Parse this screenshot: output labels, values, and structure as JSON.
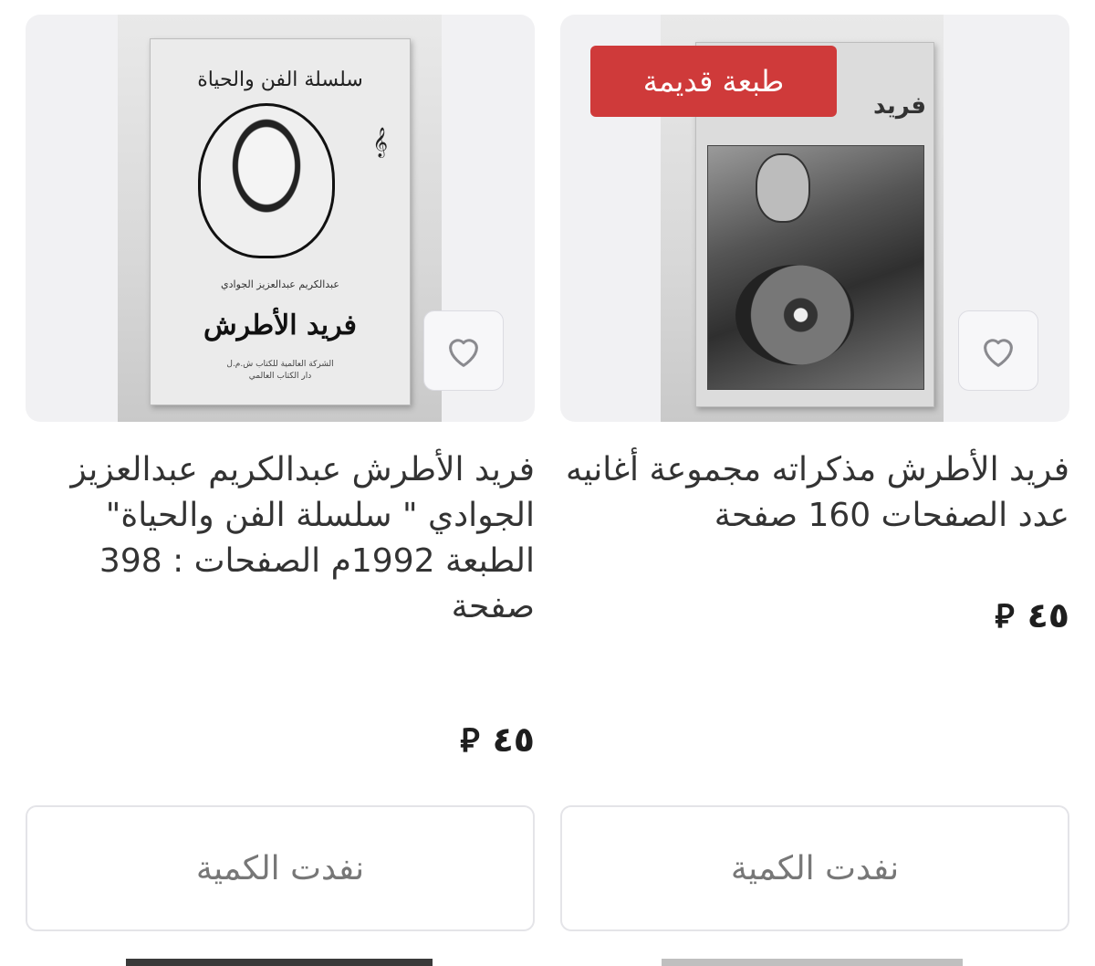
{
  "products": [
    {
      "badge": "طبعة قديمة",
      "cover_corner_text": "فريد",
      "title": "فريد الأطرش مذكراته مجموعة أغانيه عدد الصفحات 160 صفحة",
      "price": "٤٥",
      "currency": "⃁",
      "stock_label": "نفدت الكمية",
      "favorite_icon": "heart-outline-icon"
    },
    {
      "cover_series": "سلسلة الفن والحياة",
      "cover_name": "فريد الأطرش",
      "cover_author": "عبدالكريم عبدالعزيز الجوادي",
      "cover_publisher": "الشركة العالمية للكتاب ش.م.ل\nدار الكتاب العالمي",
      "title": "فريد الأطرش عبدالكريم عبدالعزيز الجوادي \" سلسلة الفن والحياة\" الطبعة 1992م الصفحات : 398 صفحة",
      "price": "٤٥",
      "currency": "⃁",
      "stock_label": "نفدت الكمية",
      "favorite_icon": "heart-outline-icon"
    }
  ],
  "colors": {
    "badge_bg": "#cf3a3a",
    "card_bg": "#f1f1f3",
    "title_text": "#333333",
    "disabled_text": "#777777"
  }
}
